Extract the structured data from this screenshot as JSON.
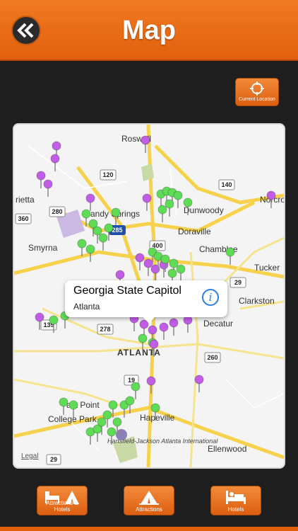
{
  "header": {
    "title": "Map",
    "back_icon": "double-chevron-left-icon"
  },
  "location_button": {
    "label": "Current Location",
    "icon": "crosshair-icon"
  },
  "map": {
    "callout": {
      "title": "Georgia State Capitol",
      "subtitle": "Atlanta"
    },
    "legal": "Legal",
    "labels": {
      "roswell": "Roswell",
      "marietta": "rietta",
      "sandy_springs": "Sandy Springs",
      "dunwoody": "Dunwoody",
      "norcross": "Norcro",
      "smyrna": "Smyrna",
      "doraville": "Doraville",
      "chamblee": "Chamblee",
      "tucker": "Tucker",
      "clarkston": "Clarkston",
      "decatur": "Decatur",
      "atlanta": "ATLANTA",
      "east_point": "ast Point",
      "college_park": "College Park",
      "hapeville": "Hapeville",
      "airport": "Hartsfield-Jackson Atlanta International",
      "ellenwood": "Ellenwood"
    },
    "shields": {
      "s120": "120",
      "s140": "140",
      "s280": "280",
      "s360": "360",
      "s285": "285",
      "s400": "400",
      "s29a": "29",
      "s278": "278",
      "s139": "139",
      "s260": "260",
      "s19": "19",
      "s29b": "29"
    },
    "pin_colors": {
      "attraction": "#c15de6",
      "hotel": "#5fdc56"
    }
  },
  "tabs": [
    {
      "label": "Attractions & Hotels",
      "icon": "bed-and-tent-icon"
    },
    {
      "label": "Attractions",
      "icon": "tent-icon"
    },
    {
      "label": "Hotels",
      "icon": "bed-icon"
    }
  ]
}
